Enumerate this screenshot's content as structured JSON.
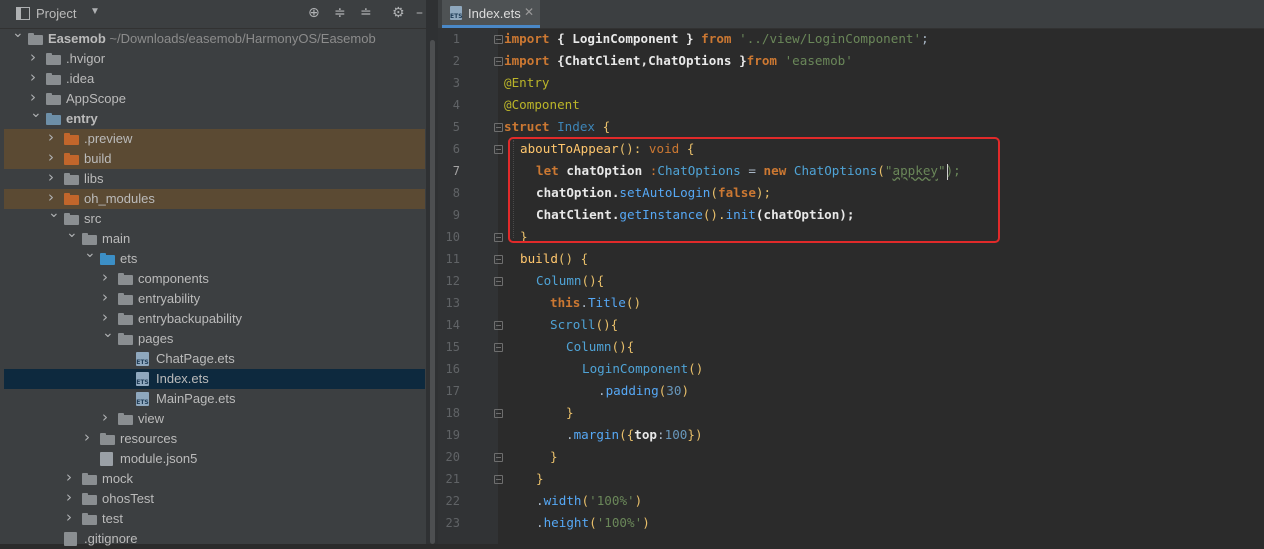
{
  "project_panel": {
    "title": "Project",
    "tree": [
      {
        "label": "Easemob",
        "path": "~/Downloads/easemob/HarmonyOS/Easemob",
        "level": 0,
        "expanded": true,
        "type": "folder-gray"
      },
      {
        "label": ".hvigor",
        "level": 1,
        "expanded": false,
        "type": "folder-gray"
      },
      {
        "label": ".idea",
        "level": 1,
        "expanded": false,
        "type": "folder-gray"
      },
      {
        "label": "AppScope",
        "level": 1,
        "expanded": false,
        "type": "folder-gray"
      },
      {
        "label": "entry",
        "level": 1,
        "expanded": true,
        "type": "folder-teal"
      },
      {
        "label": ".preview",
        "level": 2,
        "expanded": false,
        "type": "folder-orange"
      },
      {
        "label": "build",
        "level": 2,
        "expanded": false,
        "type": "folder-orange"
      },
      {
        "label": "libs",
        "level": 2,
        "expanded": false,
        "type": "folder-gray"
      },
      {
        "label": "oh_modules",
        "level": 2,
        "expanded": false,
        "type": "folder-orange"
      },
      {
        "label": "src",
        "level": 2,
        "expanded": true,
        "type": "folder-gray"
      },
      {
        "label": "main",
        "level": 3,
        "expanded": true,
        "type": "folder-gray"
      },
      {
        "label": "ets",
        "level": 4,
        "expanded": true,
        "type": "folder-blue"
      },
      {
        "label": "components",
        "level": 5,
        "expanded": false,
        "type": "folder-gray"
      },
      {
        "label": "entryability",
        "level": 5,
        "expanded": false,
        "type": "folder-gray"
      },
      {
        "label": "entrybackupability",
        "level": 5,
        "expanded": false,
        "type": "folder-gray"
      },
      {
        "label": "pages",
        "level": 5,
        "expanded": true,
        "type": "folder-gray"
      },
      {
        "label": "ChatPage.ets",
        "level": 6,
        "type": "file-ets"
      },
      {
        "label": "Index.ets",
        "level": 6,
        "type": "file-ets"
      },
      {
        "label": "MainPage.ets",
        "level": 6,
        "type": "file-ets"
      },
      {
        "label": "view",
        "level": 5,
        "expanded": false,
        "type": "folder-gray"
      },
      {
        "label": "resources",
        "level": 4,
        "expanded": false,
        "type": "folder-gray"
      },
      {
        "label": "module.json5",
        "level": 4,
        "type": "file-json"
      },
      {
        "label": "mock",
        "level": 3,
        "expanded": false,
        "type": "folder-gray"
      },
      {
        "label": "ohosTest",
        "level": 3,
        "expanded": false,
        "type": "folder-gray"
      },
      {
        "label": "test",
        "level": 3,
        "expanded": false,
        "type": "folder-gray"
      },
      {
        "label": ".gitignore",
        "level": 2,
        "type": "file-git"
      }
    ]
  },
  "editor": {
    "tab_label": "Index.ets",
    "tab_icon_text": "ETS",
    "lines": [
      "1",
      "2",
      "3",
      "4",
      "5",
      "6",
      "7",
      "8",
      "9",
      "10",
      "11",
      "12",
      "13",
      "14",
      "15",
      "16",
      "17",
      "18",
      "19",
      "20",
      "21",
      "22",
      "23"
    ],
    "code": {
      "l1": [
        "import",
        "{ LoginComponent }",
        "from",
        "'../view/LoginComponent'",
        ";"
      ],
      "l2": [
        "import",
        "{ChatClient,ChatOptions }",
        "from",
        "'easemob'"
      ],
      "l3": "@Entry",
      "l4": "@Component",
      "l5": [
        "struct",
        "Index",
        "{"
      ],
      "l6": [
        "aboutToAppear",
        "():",
        "void",
        "{"
      ],
      "l7": [
        "let",
        "chatOption",
        ":",
        "ChatOptions",
        "=",
        "new",
        "ChatOptions",
        "(",
        "\"",
        "appkey",
        "\");"
      ],
      "l8": [
        "chatOption.",
        "setAutoLogin",
        "(",
        "false",
        ");"
      ],
      "l9": [
        "ChatClient.",
        "getInstance",
        "().",
        "init",
        "(chatOption);"
      ],
      "l10": "}",
      "l11": [
        "build",
        "() {"
      ],
      "l12": [
        "Column",
        "(){"
      ],
      "l13": [
        "this",
        ".",
        "Title",
        "()"
      ],
      "l14": [
        "Scroll",
        "(){"
      ],
      "l15": [
        "Column",
        "(){"
      ],
      "l16": [
        "LoginComponent",
        "()"
      ],
      "l17": [
        ".",
        "padding",
        "(",
        "30",
        ")"
      ],
      "l18": "}",
      "l19": [
        ".",
        "margin",
        "({",
        "top",
        ":",
        "100",
        "})"
      ],
      "l20": "}",
      "l21": "}",
      "l22": [
        ".",
        "width",
        "(",
        "'100%'",
        ")"
      ],
      "l23": [
        ".",
        "height",
        "(",
        "'100%'",
        ")"
      ]
    }
  },
  "colors": {
    "highlight_box": "#e12a2a",
    "selected_row": "#0d293e",
    "excluded_row": "#5d4930"
  }
}
